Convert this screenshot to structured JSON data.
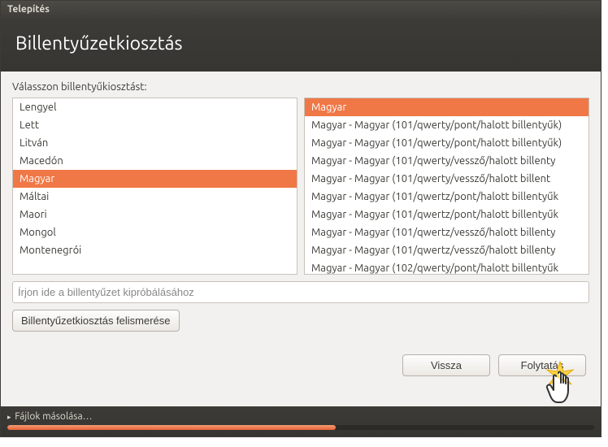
{
  "window_title": "Telepítés",
  "header": "Billentyűzetkiosztás",
  "prompt": "Válasszon billentyűkiosztást:",
  "left_list": {
    "items": [
      {
        "label": "Lengyel",
        "selected": false
      },
      {
        "label": "Lett",
        "selected": false
      },
      {
        "label": "Litván",
        "selected": false
      },
      {
        "label": "Macedón",
        "selected": false
      },
      {
        "label": "Magyar",
        "selected": true
      },
      {
        "label": "Máltai",
        "selected": false
      },
      {
        "label": "Maori",
        "selected": false
      },
      {
        "label": "Mongol",
        "selected": false
      },
      {
        "label": "Montenegrói",
        "selected": false
      }
    ]
  },
  "right_list": {
    "items": [
      {
        "label": "Magyar",
        "selected": true
      },
      {
        "label": "Magyar - Magyar (101/qwerty/pont/halott billentyűk)",
        "selected": false
      },
      {
        "label": "Magyar - Magyar (101/qwerty/pont/halott billentyűk)",
        "selected": false
      },
      {
        "label": "Magyar - Magyar (101/qwerty/vessző/halott billenty",
        "selected": false
      },
      {
        "label": "Magyar - Magyar (101/qwerty/vessző/halott billent",
        "selected": false
      },
      {
        "label": "Magyar - Magyar (101/qwertz/pont/halott billentyűk",
        "selected": false
      },
      {
        "label": "Magyar - Magyar (101/qwertz/pont/halott billentyűk",
        "selected": false
      },
      {
        "label": "Magyar - Magyar (101/qwertz/vessző/halott billenty",
        "selected": false
      },
      {
        "label": "Magyar - Magyar (101/qwertz/vessző/halott billenty",
        "selected": false
      },
      {
        "label": "Magyar - Magyar (102/qwerty/pont/halott billentyűk",
        "selected": false
      }
    ]
  },
  "test_input": {
    "placeholder": "Írjon ide a billentyűzet kipróbálásához",
    "value": ""
  },
  "detect_button": "Billentyűzetkiosztás felismerése",
  "buttons": {
    "back": "Vissza",
    "continue": "Folytatás"
  },
  "footer": {
    "label": "Fájlok másolása…",
    "progress_pct": 56
  },
  "colors": {
    "accent": "#f07746",
    "dark": "#3c3b37",
    "panel": "#f2f1f0"
  }
}
